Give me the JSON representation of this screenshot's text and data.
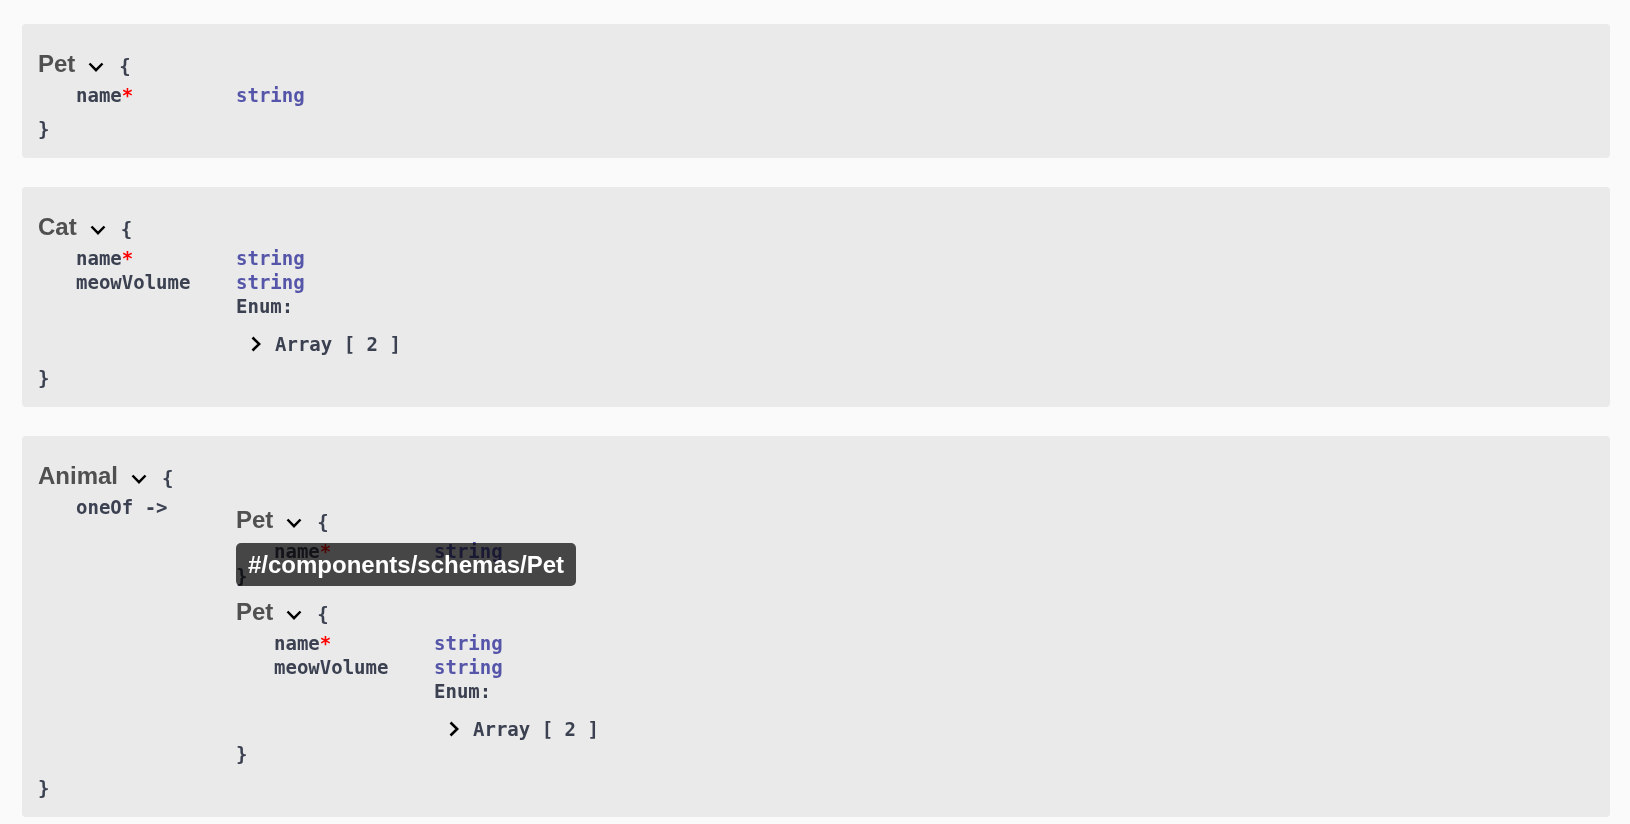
{
  "models": [
    {
      "title": "Pet",
      "expanded": true,
      "open_brace": "{",
      "close_brace": "}",
      "properties": [
        {
          "kind": "field",
          "name": "name",
          "required": true,
          "required_mark": "*",
          "type": "string"
        }
      ]
    },
    {
      "title": "Cat",
      "expanded": true,
      "open_brace": "{",
      "close_brace": "}",
      "properties": [
        {
          "kind": "field",
          "name": "name",
          "required": true,
          "required_mark": "*",
          "type": "string"
        },
        {
          "kind": "field",
          "name": "meowVolume",
          "required": false,
          "type": "string",
          "enum": {
            "label": "Enum:",
            "toggle": {
              "text": "Array [ 2 ]",
              "expanded": false
            }
          }
        }
      ]
    },
    {
      "title": "Animal",
      "expanded": true,
      "open_brace": "{",
      "close_brace": "}",
      "properties": [
        {
          "kind": "one_of",
          "name": "oneOf ->",
          "schemas": [
            {
              "title": "Pet",
              "expanded": true,
              "open_brace": "{",
              "close_brace": "}",
              "tooltip": "#/components/schemas/Pet",
              "properties": [
                {
                  "kind": "field",
                  "name": "name",
                  "required": true,
                  "required_mark": "*",
                  "type": "string"
                }
              ]
            },
            {
              "title": "Pet",
              "expanded": true,
              "open_brace": "{",
              "close_brace": "}",
              "properties": [
                {
                  "kind": "field",
                  "name": "name",
                  "required": true,
                  "required_mark": "*",
                  "type": "string"
                },
                {
                  "kind": "field",
                  "name": "meowVolume",
                  "required": false,
                  "type": "string",
                  "enum": {
                    "label": "Enum:",
                    "toggle": {
                      "text": "Array [ 2 ]",
                      "expanded": false
                    }
                  }
                }
              ]
            }
          ]
        }
      ]
    }
  ]
}
